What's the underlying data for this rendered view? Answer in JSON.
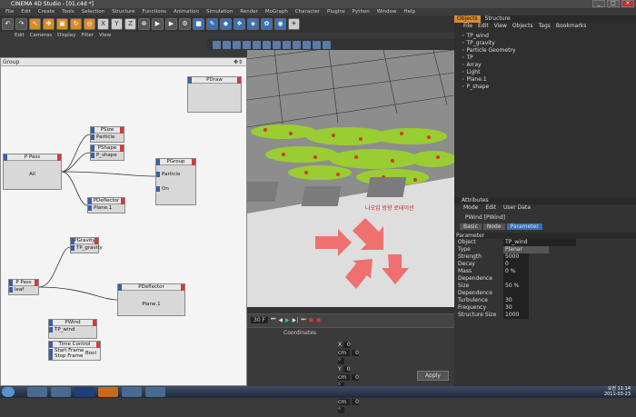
{
  "window": {
    "title": "CINEMA 4D Studio - [01.c4d *]"
  },
  "menu": [
    "File",
    "Edit",
    "Create",
    "Tools",
    "Selection",
    "Structure",
    "Functions",
    "Animation",
    "Simulation",
    "Render",
    "MoGraph",
    "Character",
    "Plugins",
    "Python",
    "Window",
    "Help"
  ],
  "view_menu": [
    "Edit",
    "Cameras",
    "Display",
    "Filter",
    "View"
  ],
  "xpresso": {
    "title": "Group",
    "nodes": {
      "pdraw": "PDraw",
      "ppass1": {
        "title": "P Pass",
        "value": "All"
      },
      "psize": {
        "title": "PSize",
        "port": "Particle"
      },
      "pshape": {
        "title": "PShape",
        "port": "P_shape"
      },
      "pgroup": {
        "title": "PGroup",
        "ports": [
          "Particle",
          "On"
        ]
      },
      "pdeflector1": {
        "title": "PDeflector",
        "port": "Plane.1"
      },
      "pgravity": {
        "title": "PGravity",
        "port": "TP_gravity"
      },
      "ppass2": {
        "title": "P Pass",
        "port": "leaf"
      },
      "pdeflector2": {
        "title": "PDeflector",
        "value": "Plane.1"
      },
      "pwind": {
        "title": "PWind",
        "value": "TP_wind"
      },
      "timecontrol": {
        "title": "Time Control",
        "ports": [
          "Start Frame",
          "Stop Frame"
        ],
        "out": "Bool"
      }
    }
  },
  "viewport": {
    "annotation": "나오임 방향 로테이션"
  },
  "timeline": {
    "frame": "30 F"
  },
  "coords": {
    "title": "Coordinates",
    "labels": [
      "X",
      "Y",
      "Z"
    ],
    "apply": "Apply",
    "pos": "0 cm",
    "rot": "0 °"
  },
  "objects": {
    "tabs": [
      "Objects",
      "Structure"
    ],
    "menu": [
      "File",
      "Edit",
      "View",
      "Objects",
      "Tags",
      "Bookmarks"
    ],
    "items": [
      "TP_wind",
      "TP_gravity",
      "Particle Geometry",
      "TP",
      "Array",
      "Light",
      "Plane.1",
      "P_shape"
    ]
  },
  "attributes": {
    "tab": "Attributes",
    "menu": [
      "Mode",
      "Edit",
      "User Data"
    ],
    "object": "PWind [PWind]",
    "tabs": [
      "Basic",
      "Node",
      "Parameter"
    ],
    "section": "Parameter",
    "params": [
      {
        "label": "Object",
        "value": "TP_wind"
      },
      {
        "label": "Type",
        "value": "Planar"
      },
      {
        "label": "Strength",
        "value": "5000"
      },
      {
        "label": "Decay",
        "value": "0"
      },
      {
        "label": "Mass Dependence",
        "value": "0 %"
      },
      {
        "label": "Size Dependence",
        "value": "50 %"
      },
      {
        "label": "Turbulence",
        "value": "30"
      },
      {
        "label": "Frequency",
        "value": "30"
      },
      {
        "label": "Structure Size",
        "value": "1000"
      }
    ]
  },
  "taskbar": {
    "time": "오전 11:14",
    "date": "2011-03-23"
  },
  "colors": {
    "accent": "#d98a2a",
    "select": "#3a6fb5",
    "arrow": "#f06a6a"
  }
}
